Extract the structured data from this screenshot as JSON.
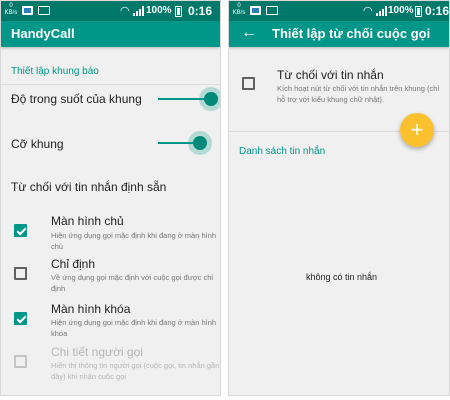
{
  "status_bar": {
    "net_speed": "0",
    "net_unit": "KB/s",
    "battery_pct": "100%",
    "time": "0:16"
  },
  "left": {
    "app_title": "HandyCall",
    "section_frame": "Thiết lập khung báo",
    "transparency_label": "Độ trong suốt của khung",
    "transparency_value": 1.0,
    "size_label": "Cỡ khung",
    "size_value": 0.95,
    "reject_section": "Từ chối với tin nhắn định sẵn",
    "options": [
      {
        "title": "Màn hình chủ",
        "desc": "Hiện ứng dụng gọi mặc định khi đang ở màn hình chủ",
        "checked": true,
        "disabled": false
      },
      {
        "title": "Chỉ định",
        "desc": "Về ứng dụng gọi mặc định với cuộc gọi được chỉ định",
        "checked": false,
        "disabled": false
      },
      {
        "title": "Màn hình khóa",
        "desc": "Hiện ứng dụng gọi mặc định khi đang ở màn hình khóa",
        "checked": true,
        "disabled": false
      },
      {
        "title": "Chi tiết người gọi",
        "desc": "Hiển thị thông tin người gọi (cuộc gọi, tin nhắn gần đây) khi nhận cuộc gọi",
        "checked": false,
        "disabled": true
      }
    ]
  },
  "right": {
    "app_title": "Thiết lập từ chối cuộc gọi",
    "back_icon": "arrow-back-icon",
    "reject_title": "Từ chối với tin nhắn",
    "reject_desc": "Kích hoạt nút từ chối với tin nhắn trên khung (chỉ hỗ trợ với kiểu khung chữ nhật).",
    "reject_checked": false,
    "list_section": "Danh sách tin nhắn",
    "fab_icon": "+",
    "empty_message": "không có tin nhắn"
  },
  "colors": {
    "status_bar": "#00796b",
    "app_bar": "#009688",
    "accent": "#009688",
    "fab": "#fbc02d"
  }
}
